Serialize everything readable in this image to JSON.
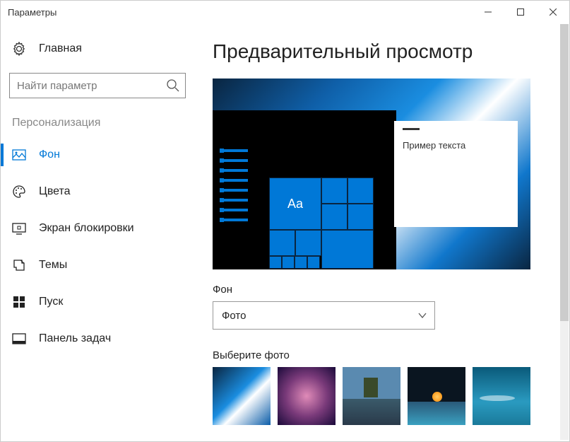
{
  "titlebar": {
    "title": "Параметры"
  },
  "sidebar": {
    "home_label": "Главная",
    "search_placeholder": "Найти параметр",
    "section_label": "Персонализация",
    "items": [
      {
        "label": "Фон",
        "icon": "image-icon",
        "active": true
      },
      {
        "label": "Цвета",
        "icon": "palette-icon"
      },
      {
        "label": "Экран блокировки",
        "icon": "lock-screen-icon"
      },
      {
        "label": "Темы",
        "icon": "themes-icon"
      },
      {
        "label": "Пуск",
        "icon": "start-icon"
      },
      {
        "label": "Панель задач",
        "icon": "taskbar-icon"
      }
    ]
  },
  "main": {
    "heading": "Предварительный просмотр",
    "preview": {
      "sample_text": "Пример текста",
      "tile_text": "Aa"
    },
    "background_label": "Фон",
    "background_select_value": "Фото",
    "choose_photo_label": "Выберите фото"
  }
}
